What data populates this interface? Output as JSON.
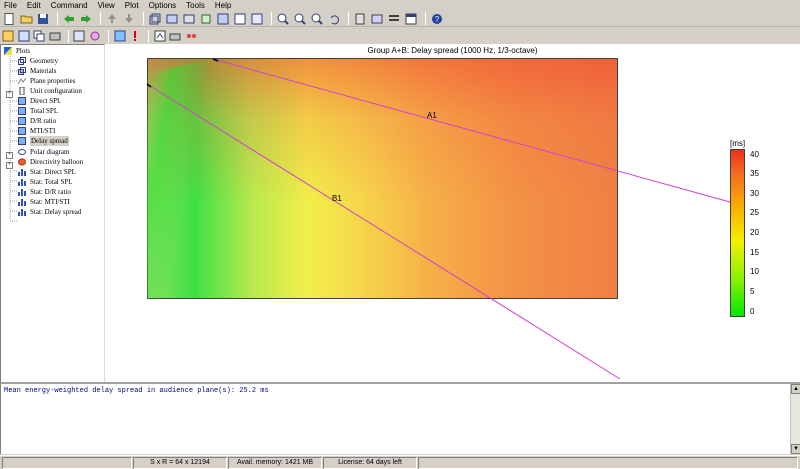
{
  "menu": [
    "File",
    "Edit",
    "Command",
    "View",
    "Plot",
    "Options",
    "Tools",
    "Help"
  ],
  "toolbar_icons": [
    "new-icon",
    "open-icon",
    "save-icon",
    "back-icon",
    "forward-icon",
    "up-icon",
    "down-icon",
    "view-icon",
    "zoom-in-icon",
    "zoom-out-icon",
    "help-icon"
  ],
  "tree": {
    "items": [
      {
        "label": "Plots",
        "level": 0
      },
      {
        "label": "Geometry",
        "level": 1
      },
      {
        "label": "Materials",
        "level": 1
      },
      {
        "label": "Plane properties",
        "level": 1
      },
      {
        "label": "Unit configuration",
        "level": 1
      },
      {
        "label": "Direct SPL",
        "level": 1
      },
      {
        "label": "Total SPL",
        "level": 1
      },
      {
        "label": "D/R ratio",
        "level": 1
      },
      {
        "label": "MTI/STI",
        "level": 1
      },
      {
        "label": "Delay spread",
        "level": 1
      },
      {
        "label": "Polar diagram",
        "level": 1
      },
      {
        "label": "Directivity balloon",
        "level": 1
      },
      {
        "label": "Stat: Direct SPL",
        "level": 1
      },
      {
        "label": "Stat: Total SPL",
        "level": 1
      },
      {
        "label": "Stat: D/R ratio",
        "level": 1
      },
      {
        "label": "Stat: MTI/STI",
        "level": 1
      },
      {
        "label": "Stat: Delay spread",
        "level": 1
      }
    ],
    "selected": "Delay spread"
  },
  "plot": {
    "title": "Group A+B: Delay spread (1000 Hz, 1/3-octave)",
    "line_labels": [
      "A1",
      "B1"
    ],
    "line_color": "#d040d0"
  },
  "legend": {
    "unit": "[ms]",
    "ticks": [
      "40",
      "35",
      "30",
      "25",
      "20",
      "15",
      "10",
      "5",
      "0"
    ]
  },
  "output": {
    "text": "Mean energy-weighted delay spread in audience plane(s): 25.2 ms"
  },
  "status": {
    "size": "S x R = 64 x 12194",
    "memory": "Avail. memory: 1421 MB",
    "license": "License: 64 days left"
  }
}
